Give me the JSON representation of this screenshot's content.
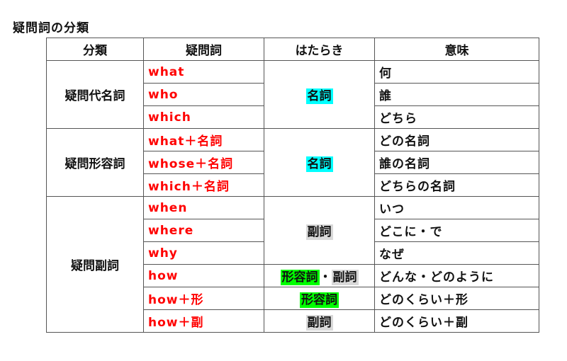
{
  "title": "疑問詞の分類",
  "headers": [
    "分類",
    "疑問詞",
    "はたらき",
    "意味"
  ],
  "groups": [
    {
      "category": "疑問代名詞",
      "rows": [
        {
          "word": "what",
          "meaning": "何"
        },
        {
          "word": "who",
          "meaning": "誰"
        },
        {
          "word": "which",
          "meaning": "どちら"
        }
      ],
      "function": [
        {
          "label": "名詞",
          "color": "#00ffff"
        }
      ]
    },
    {
      "category": "疑問形容詞",
      "rows": [
        {
          "word": "what＋名詞",
          "meaning": "どの名詞"
        },
        {
          "word": "whose＋名詞",
          "meaning": "誰の名詞"
        },
        {
          "word": "which＋名詞",
          "meaning": "どちらの名詞"
        }
      ],
      "function": [
        {
          "label": "名詞",
          "color": "#00ffff"
        }
      ]
    },
    {
      "category": "疑問副詞",
      "rows": [
        {
          "word": "when",
          "meaning": "いつ"
        },
        {
          "word": "where",
          "meaning": "どこに・で"
        },
        {
          "word": "why",
          "meaning": "なぜ"
        },
        {
          "word": "how",
          "meaning": "どんな・どのように"
        },
        {
          "word": "how＋形",
          "meaning": "どのくらい＋形"
        },
        {
          "word": "how＋副",
          "meaning": "どのくらい＋副"
        }
      ],
      "function_adverb": {
        "label": "副詞",
        "color": "#d9d9d9"
      },
      "function_how": {
        "adj": "形容詞",
        "sep": "・",
        "adv": "副詞",
        "adj_color": "#00ff00",
        "adv_color": "#d9d9d9"
      },
      "function_how_adj": {
        "label": "形容詞",
        "color": "#00ff00"
      },
      "function_how_adv": {
        "label": "副詞",
        "color": "#d9d9d9"
      }
    }
  ],
  "colors": {
    "word_text": "#ff0000"
  }
}
